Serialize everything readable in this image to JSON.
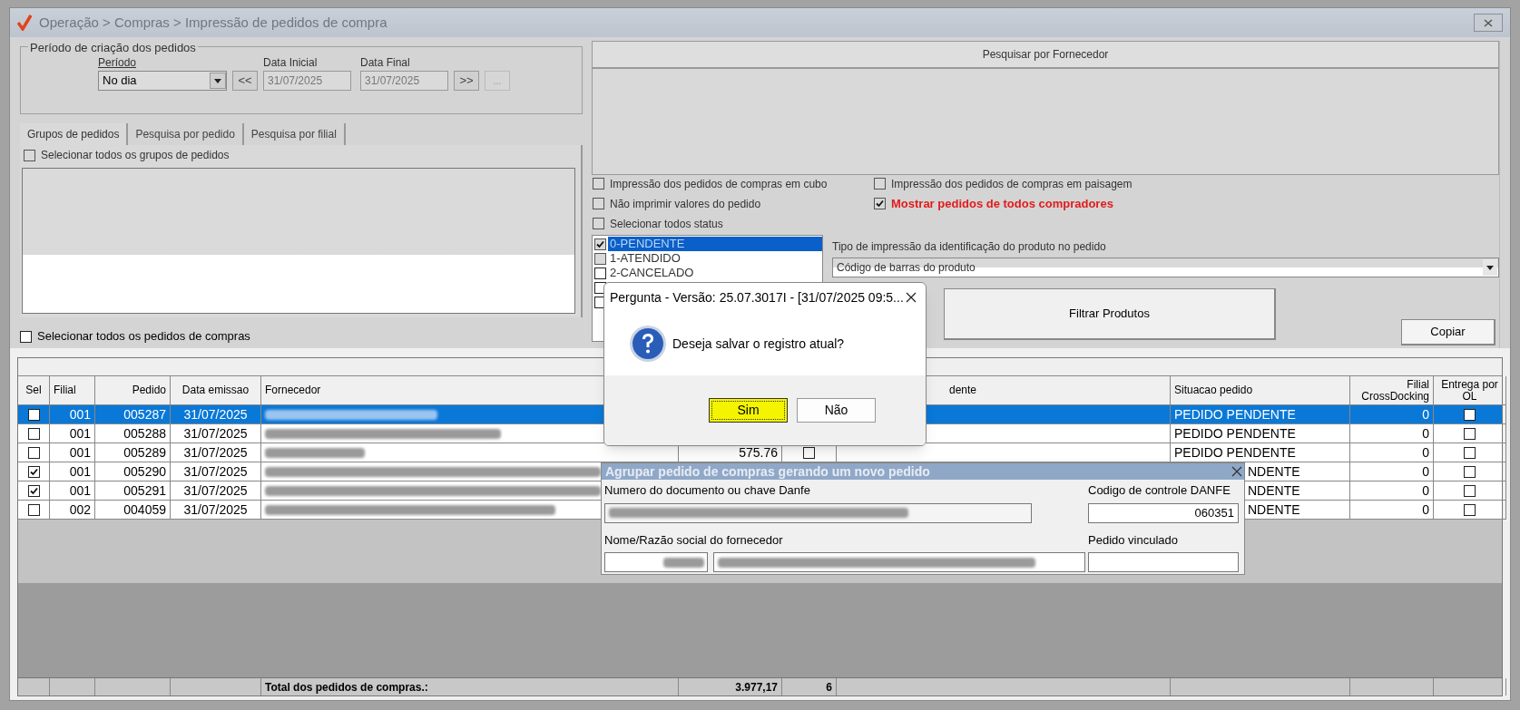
{
  "window": {
    "title": "Operação > Compras > Impressão de pedidos de compra"
  },
  "period_group": {
    "title": "Período de criação dos pedidos",
    "period_label": "Período",
    "period_value": "No dia",
    "prev_button": "<<",
    "start_label": "Data Inicial",
    "start_value": "31/07/2025",
    "end_label": "Data Final",
    "end_value": "31/07/2025",
    "next_button": ">>",
    "more_button": "..."
  },
  "tabs": [
    {
      "label": "Grupos de pedidos",
      "selected": true
    },
    {
      "label": "Pesquisa por pedido",
      "selected": false
    },
    {
      "label": "Pesquisa por filial",
      "selected": false
    }
  ],
  "select_all_groups": {
    "label": "Selecionar todos os grupos de pedidos",
    "checked": false
  },
  "select_all_orders": {
    "label": "Selecionar todos os pedidos de compras",
    "checked": false
  },
  "supplier_search": {
    "title": "Pesquisar por Fornecedor"
  },
  "options": [
    {
      "label": "Impressão dos pedidos de compras em cubo",
      "checked": false,
      "highlight": false
    },
    {
      "label": "Impressão dos pedidos de compras em paisagem",
      "checked": false,
      "highlight": false
    },
    {
      "label": "Não imprimir valores do pedido",
      "checked": false,
      "highlight": false
    },
    {
      "label": "Mostrar pedidos de todos compradores",
      "checked": true,
      "highlight": true
    },
    {
      "label": "Selecionar todos status",
      "checked": false,
      "highlight": false
    }
  ],
  "status_list": [
    {
      "label": "0-PENDENTE",
      "checked": true,
      "selected": true
    },
    {
      "label": "1-ATENDIDO",
      "checked": false,
      "selected": false
    },
    {
      "label": "2-CANCELADO",
      "checked": false,
      "selected": false
    },
    {
      "checked": false,
      "selected": false
    },
    {
      "checked": false,
      "selected": false
    }
  ],
  "product_id": {
    "label": "Tipo de impressão da identificação do produto no pedido",
    "value": "Código de barras do produto"
  },
  "filter_button": "Filtrar Produtos",
  "copy_button": "Copiar",
  "table": {
    "columns": [
      {
        "label": "Sel"
      },
      {
        "label": "Filial"
      },
      {
        "label": "Pedido"
      },
      {
        "label": "Data emissao"
      },
      {
        "label": "Fornecedor"
      },
      {},
      {},
      {
        "label": "dente"
      },
      {
        "label": "Situacao pedido"
      },
      {
        "label": "Filial CrossDocking"
      },
      {
        "label": "Entrega por OL"
      }
    ],
    "rows": [
      {
        "selected": true,
        "sel": false,
        "filial": "001",
        "pedido": "005287",
        "data": "31/07/2025",
        "situacao": "PEDIDO PENDENTE",
        "crossdocking": "0",
        "ol": false
      },
      {
        "selected": false,
        "sel": false,
        "filial": "001",
        "pedido": "005288",
        "data": "31/07/2025",
        "situacao": "PEDIDO PENDENTE",
        "crossdocking": "0",
        "ol": false
      },
      {
        "selected": false,
        "sel": false,
        "filial": "001",
        "pedido": "005289",
        "data": "31/07/2025",
        "value": "575.76",
        "flag": false,
        "situacao": "PEDIDO PENDENTE",
        "crossdocking": "0",
        "ol": false
      },
      {
        "selected": false,
        "sel": true,
        "filial": "001",
        "pedido": "005290",
        "data": "31/07/2025",
        "situacao_cut": "NDENTE",
        "crossdocking": "0",
        "ol": false
      },
      {
        "selected": false,
        "sel": true,
        "filial": "001",
        "pedido": "005291",
        "data": "31/07/2025",
        "situacao_cut": "NDENTE",
        "crossdocking": "0",
        "ol": false
      },
      {
        "selected": false,
        "sel": false,
        "filial": "002",
        "pedido": "004059",
        "data": "31/07/2025",
        "situacao_cut": "NDENTE",
        "crossdocking": "0",
        "ol": false
      }
    ],
    "footer": {
      "label": "Total dos pedidos de compras.:",
      "total": "3.977,17",
      "count": "6"
    }
  },
  "dialog": {
    "title": "Pergunta - Versão: 25.07.3017I - [31/07/2025 09:5...",
    "message": "Deseja salvar o registro atual?",
    "buttons": [
      {
        "label": "Sim",
        "selected": true
      },
      {
        "label": "Não",
        "selected": false
      }
    ]
  },
  "group_panel": {
    "title": "Agrupar pedido de compras gerando um novo pedido",
    "doc_label": "Numero do documento ou chave Danfe",
    "control_label": "Codigo de controle DANFE",
    "control_value": "060351",
    "supplier_label": "Nome/Razão social do fornecedor",
    "linked_label": "Pedido vinculado"
  }
}
